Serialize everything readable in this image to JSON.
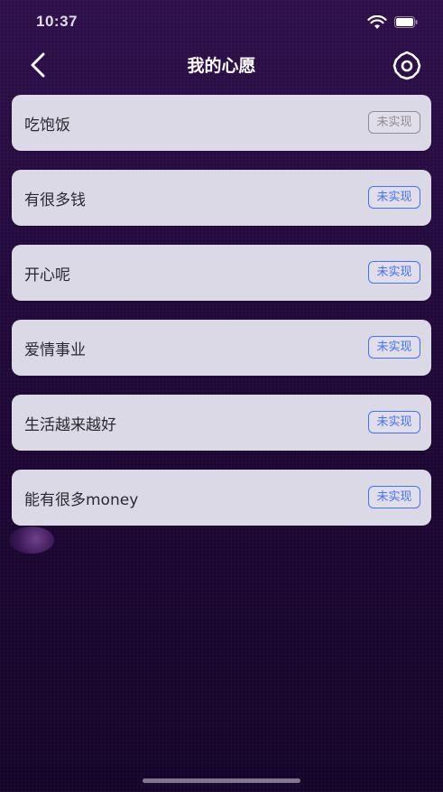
{
  "status_bar": {
    "time": "10:37"
  },
  "nav": {
    "title": "我的心愿",
    "back_icon": "chevron-left-icon",
    "settings_icon": "gear-icon"
  },
  "wishes": [
    {
      "text": "吃饱饭",
      "status": "未实现"
    },
    {
      "text": "有很多钱",
      "status": "未实现"
    },
    {
      "text": "开心呢",
      "status": "未实现"
    },
    {
      "text": "爱情事业",
      "status": "未实现"
    },
    {
      "text": "生活越来越好",
      "status": "未实现"
    },
    {
      "text": "能有很多money",
      "status": "未实现"
    }
  ],
  "colors": {
    "background": "#240b3f",
    "card": "#dcd9e6",
    "accent": "#3f73ff",
    "muted": "#8e8c96"
  }
}
